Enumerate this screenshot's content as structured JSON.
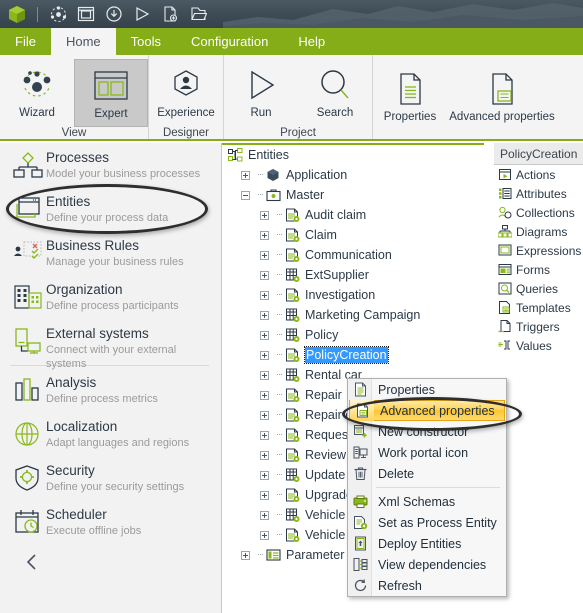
{
  "titlebar": {
    "icons": [
      {
        "name": "app-logo-icon",
        "label": "Bizagi"
      },
      {
        "name": "process-wheel-icon",
        "label": "Process wheel"
      },
      {
        "name": "window-layout-icon",
        "label": "Window layout"
      },
      {
        "name": "download-circle-icon",
        "label": "Download"
      },
      {
        "name": "run-play-icon",
        "label": "Run"
      },
      {
        "name": "new-document-icon",
        "label": "New document"
      },
      {
        "name": "open-folder-icon",
        "label": "Open"
      }
    ]
  },
  "menubar": {
    "items": [
      {
        "label": "File",
        "active": false
      },
      {
        "label": "Home",
        "active": true
      },
      {
        "label": "Tools",
        "active": false
      },
      {
        "label": "Configuration",
        "active": false
      },
      {
        "label": "Help",
        "active": false
      }
    ]
  },
  "ribbon": {
    "groups": [
      {
        "label": "View",
        "buttons": [
          {
            "label": "Wizard",
            "icon": "wizard-nodes-icon",
            "selected": false
          },
          {
            "label": "Expert",
            "icon": "expert-panels-icon",
            "selected": true
          }
        ]
      },
      {
        "label": "Designer",
        "buttons": [
          {
            "label": "Experience",
            "icon": "experience-person-icon",
            "selected": false
          }
        ]
      },
      {
        "label": "Project",
        "buttons": [
          {
            "label": "Run",
            "icon": "run-triangle-icon",
            "selected": false
          },
          {
            "label": "Search",
            "icon": "search-magnifier-icon",
            "selected": false
          }
        ]
      },
      {
        "label": "",
        "buttons": [
          {
            "label": "Properties",
            "icon": "properties-document-icon",
            "selected": false
          },
          {
            "label": "Advanced properties",
            "icon": "advanced-properties-document-icon",
            "selected": false
          }
        ]
      }
    ]
  },
  "sidebar": {
    "items": [
      {
        "title": "Processes",
        "subtitle": "Model your business processes",
        "icon": "processes-icon",
        "highlighted": false
      },
      {
        "title": "Entities",
        "subtitle": "Define your process data",
        "icon": "entities-icon",
        "highlighted": true
      },
      {
        "title": "Business Rules",
        "subtitle": "Manage your business rules",
        "icon": "business-rules-icon",
        "highlighted": false
      },
      {
        "title": "Organization",
        "subtitle": "Define process participants",
        "icon": "organization-icon",
        "highlighted": false
      },
      {
        "title": "External systems",
        "subtitle": "Connect with your external systems",
        "icon": "external-systems-icon",
        "highlighted": false
      },
      {
        "title": "Analysis",
        "subtitle": "Define process metrics",
        "icon": "analysis-icon",
        "highlighted": false
      },
      {
        "title": "Localization",
        "subtitle": "Adapt languages and regions",
        "icon": "localization-icon",
        "highlighted": false
      },
      {
        "title": "Security",
        "subtitle": "Define your security settings",
        "icon": "security-icon",
        "highlighted": false
      },
      {
        "title": "Scheduler",
        "subtitle": "Execute offline jobs",
        "icon": "scheduler-icon",
        "highlighted": false
      }
    ],
    "collapse_icon": "chevron-left-icon"
  },
  "tree": {
    "rows": [
      {
        "label": "Entities",
        "level": 0,
        "toggle": "none",
        "icon": "entities-root-icon",
        "selected": false
      },
      {
        "label": "Application",
        "level": 1,
        "toggle": "plus",
        "icon": "application-cube-icon",
        "selected": false
      },
      {
        "label": "Master",
        "level": 1,
        "toggle": "minus",
        "icon": "master-briefcase-icon",
        "selected": false
      },
      {
        "label": "Audit claim",
        "level": 2,
        "toggle": "plus",
        "icon": "entity-master-icon",
        "selected": false
      },
      {
        "label": "Claim",
        "level": 2,
        "toggle": "plus",
        "icon": "entity-master-icon",
        "selected": false
      },
      {
        "label": "Communication",
        "level": 2,
        "toggle": "plus",
        "icon": "entity-master-icon",
        "selected": false
      },
      {
        "label": "ExtSupplier",
        "level": 2,
        "toggle": "plus",
        "icon": "entity-parametric-icon",
        "selected": false
      },
      {
        "label": "Investigation",
        "level": 2,
        "toggle": "plus",
        "icon": "entity-master-icon",
        "selected": false
      },
      {
        "label": "Marketing Campaign",
        "level": 2,
        "toggle": "plus",
        "icon": "entity-parametric-icon",
        "selected": false
      },
      {
        "label": "Policy",
        "level": 2,
        "toggle": "plus",
        "icon": "entity-parametric-icon",
        "selected": false
      },
      {
        "label": "PolicyCreation",
        "level": 2,
        "toggle": "plus",
        "icon": "entity-master-icon",
        "selected": true
      },
      {
        "label": "Rental car",
        "level": 2,
        "toggle": "plus",
        "icon": "entity-parametric-icon",
        "selected": false
      },
      {
        "label": "Repair",
        "level": 2,
        "toggle": "plus",
        "icon": "entity-master-icon",
        "selected": false
      },
      {
        "label": "Repair confi",
        "level": 2,
        "toggle": "plus",
        "icon": "entity-master-icon",
        "selected": false
      },
      {
        "label": "RequestSoli",
        "level": 2,
        "toggle": "plus",
        "icon": "entity-master-icon",
        "selected": false
      },
      {
        "label": "Review satis",
        "level": 2,
        "toggle": "plus",
        "icon": "entity-master-icon",
        "selected": false
      },
      {
        "label": "Update repa",
        "level": 2,
        "toggle": "plus",
        "icon": "entity-parametric-icon",
        "selected": false
      },
      {
        "label": "Upgrade Po",
        "level": 2,
        "toggle": "plus",
        "icon": "entity-master-icon",
        "selected": false
      },
      {
        "label": "Vehicle",
        "level": 2,
        "toggle": "plus",
        "icon": "entity-parametric-icon",
        "selected": false
      },
      {
        "label": "Vehicle Loca",
        "level": 2,
        "toggle": "plus",
        "icon": "entity-master-icon",
        "selected": false
      },
      {
        "label": "Parameter",
        "level": 1,
        "toggle": "plus",
        "icon": "parameter-icon",
        "selected": false
      }
    ]
  },
  "right_panel": {
    "tab_label": "PolicyCreation",
    "items": [
      {
        "label": "Actions",
        "icon": "actions-icon"
      },
      {
        "label": "Attributes",
        "icon": "attributes-icon"
      },
      {
        "label": "Collections",
        "icon": "collections-icon"
      },
      {
        "label": "Diagrams",
        "icon": "diagrams-icon"
      },
      {
        "label": "Expressions",
        "icon": "expressions-icon"
      },
      {
        "label": "Forms",
        "icon": "forms-icon"
      },
      {
        "label": "Queries",
        "icon": "queries-icon"
      },
      {
        "label": "Templates",
        "icon": "templates-icon"
      },
      {
        "label": "Triggers",
        "icon": "triggers-icon"
      },
      {
        "label": "Values",
        "icon": "values-icon"
      }
    ]
  },
  "context_menu": {
    "items": [
      {
        "label": "Properties",
        "icon": "properties-doc-icon",
        "highlighted": false,
        "separator_after": false
      },
      {
        "label": "Advanced properties",
        "icon": "advanced-properties-doc-icon",
        "highlighted": true,
        "separator_after": false
      },
      {
        "label": "New constructor",
        "icon": "new-constructor-icon",
        "highlighted": false,
        "separator_after": false
      },
      {
        "label": "Work portal icon",
        "icon": "work-portal-icon",
        "highlighted": false,
        "separator_after": false
      },
      {
        "label": "Delete",
        "icon": "trash-icon",
        "highlighted": false,
        "separator_after": true
      },
      {
        "label": "Xml Schemas",
        "icon": "xml-schemas-icon",
        "highlighted": false,
        "separator_after": false
      },
      {
        "label": "Set as Process Entity",
        "icon": "set-process-entity-icon",
        "highlighted": false,
        "separator_after": false
      },
      {
        "label": "Deploy Entities",
        "icon": "deploy-entities-icon",
        "highlighted": false,
        "separator_after": false
      },
      {
        "label": "View dependencies",
        "icon": "view-dependencies-icon",
        "highlighted": false,
        "separator_after": false
      },
      {
        "label": "Refresh",
        "icon": "refresh-icon",
        "highlighted": false,
        "separator_after": false
      }
    ]
  },
  "colors": {
    "brand_green": "#84ad17",
    "titlebar_dark": "#3e4b54",
    "highlight_yellow": "#fec52f",
    "selection_blue": "#3399ff",
    "ribbon_bg": "#f4f4f4",
    "sidebar_bg": "#f2f2f2"
  }
}
